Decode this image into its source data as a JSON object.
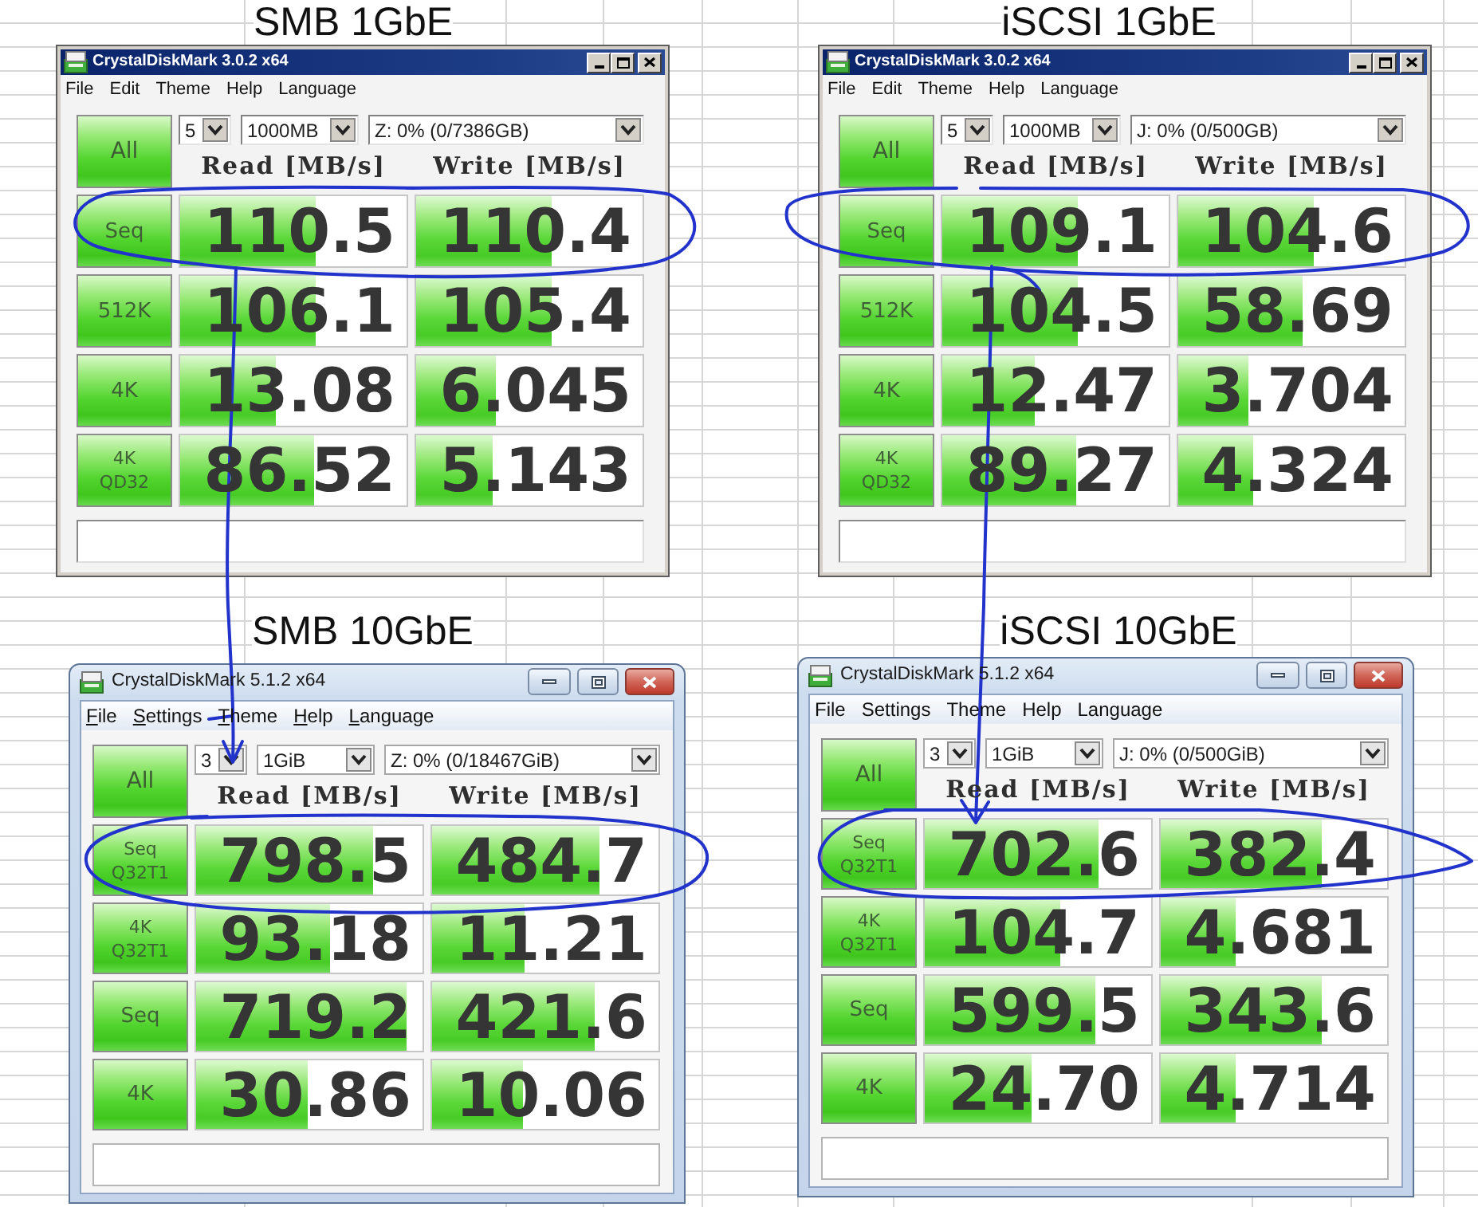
{
  "panels": [
    {
      "heading": "SMB 1GbE",
      "window": {
        "kind": "classic",
        "title": "CrystalDiskMark 3.0.2 x64",
        "access_keys_underlined": false,
        "menu": [
          "File",
          "Edit",
          "Theme",
          "Help",
          "Language"
        ],
        "all_button": "All",
        "selects": [
          "5",
          "1000MB",
          "Z: 0% (0/7386GB)"
        ],
        "columns": [
          "Read [MB/s]",
          "Write [MB/s]"
        ],
        "rows": [
          {
            "label": [
              "Seq"
            ],
            "read": {
              "value": "110.5",
              "level": 0.6
            },
            "write": {
              "value": "110.4",
              "level": 0.6
            }
          },
          {
            "label": [
              "512K"
            ],
            "read": {
              "value": "106.1",
              "level": 0.6
            },
            "write": {
              "value": "105.4",
              "level": 0.6
            }
          },
          {
            "label": [
              "4K"
            ],
            "read": {
              "value": "13.08",
              "level": 0.42
            },
            "write": {
              "value": "6.045",
              "level": 0.35
            }
          },
          {
            "label": [
              "4K",
              "QD32"
            ],
            "read": {
              "value": "86.52",
              "level": 0.59
            },
            "write": {
              "value": "5.143",
              "level": 0.34
            }
          }
        ]
      }
    },
    {
      "heading": "iSCSI 1GbE",
      "window": {
        "kind": "classic",
        "title": "CrystalDiskMark 3.0.2 x64",
        "access_keys_underlined": false,
        "menu": [
          "File",
          "Edit",
          "Theme",
          "Help",
          "Language"
        ],
        "all_button": "All",
        "selects": [
          "5",
          "1000MB",
          "J: 0% (0/500GB)"
        ],
        "columns": [
          "Read [MB/s]",
          "Write [MB/s]"
        ],
        "rows": [
          {
            "label": [
              "Seq"
            ],
            "read": {
              "value": "109.1",
              "level": 0.6
            },
            "write": {
              "value": "104.6",
              "level": 0.6
            }
          },
          {
            "label": [
              "512K"
            ],
            "read": {
              "value": "104.5",
              "level": 0.6
            },
            "write": {
              "value": "58.69",
              "level": 0.55
            }
          },
          {
            "label": [
              "4K"
            ],
            "read": {
              "value": "12.47",
              "level": 0.41
            },
            "write": {
              "value": "3.704",
              "level": 0.31
            }
          },
          {
            "label": [
              "4K",
              "QD32"
            ],
            "read": {
              "value": "89.27",
              "level": 0.59
            },
            "write": {
              "value": "4.324",
              "level": 0.33
            }
          }
        ]
      }
    },
    {
      "heading": "SMB 10GbE",
      "window": {
        "kind": "aero",
        "title": "CrystalDiskMark 5.1.2 x64",
        "access_keys_underlined": true,
        "menu": [
          "File",
          "Settings",
          "Theme",
          "Help",
          "Language"
        ],
        "all_button": "All",
        "selects": [
          "3",
          "1GiB",
          "Z: 0% (0/18467GiB)"
        ],
        "columns": [
          "Read [MB/s]",
          "Write [MB/s]"
        ],
        "rows": [
          {
            "label": [
              "Seq",
              "Q32T1"
            ],
            "read": {
              "value": "798.5",
              "level": 0.78
            },
            "write": {
              "value": "484.7",
              "level": 0.74
            }
          },
          {
            "label": [
              "4K",
              "Q32T1"
            ],
            "read": {
              "value": "93.18",
              "level": 0.59
            },
            "write": {
              "value": "11.21",
              "level": 0.41
            }
          },
          {
            "label": [
              "Seq"
            ],
            "read": {
              "value": "719.2",
              "level": 0.93
            },
            "write": {
              "value": "421.6",
              "level": 0.72
            }
          },
          {
            "label": [
              "4K"
            ],
            "read": {
              "value": "30.86",
              "level": 0.49
            },
            "write": {
              "value": "10.06",
              "level": 0.4
            }
          }
        ]
      }
    },
    {
      "heading": "iSCSI 10GbE",
      "window": {
        "kind": "aero",
        "title": "CrystalDiskMark 5.1.2 x64",
        "access_keys_underlined": false,
        "menu": [
          "File",
          "Settings",
          "Theme",
          "Help",
          "Language"
        ],
        "all_button": "All",
        "selects": [
          "3",
          "1GiB",
          "J: 0% (0/500GiB)"
        ],
        "columns": [
          "Read [MB/s]",
          "Write [MB/s]"
        ],
        "rows": [
          {
            "label": [
              "Seq",
              "Q32T1"
            ],
            "read": {
              "value": "702.6",
              "level": 0.77
            },
            "write": {
              "value": "382.4",
              "level": 0.71
            }
          },
          {
            "label": [
              "4K",
              "Q32T1"
            ],
            "read": {
              "value": "104.7",
              "level": 0.6
            },
            "write": {
              "value": "4.681",
              "level": 0.33
            }
          },
          {
            "label": [
              "Seq"
            ],
            "read": {
              "value": "599.5",
              "level": 0.75
            },
            "write": {
              "value": "343.6",
              "level": 0.71
            }
          },
          {
            "label": [
              "4K"
            ],
            "read": {
              "value": "24.70",
              "level": 0.47
            },
            "write": {
              "value": "4.714",
              "level": 0.33
            }
          }
        ]
      }
    }
  ]
}
